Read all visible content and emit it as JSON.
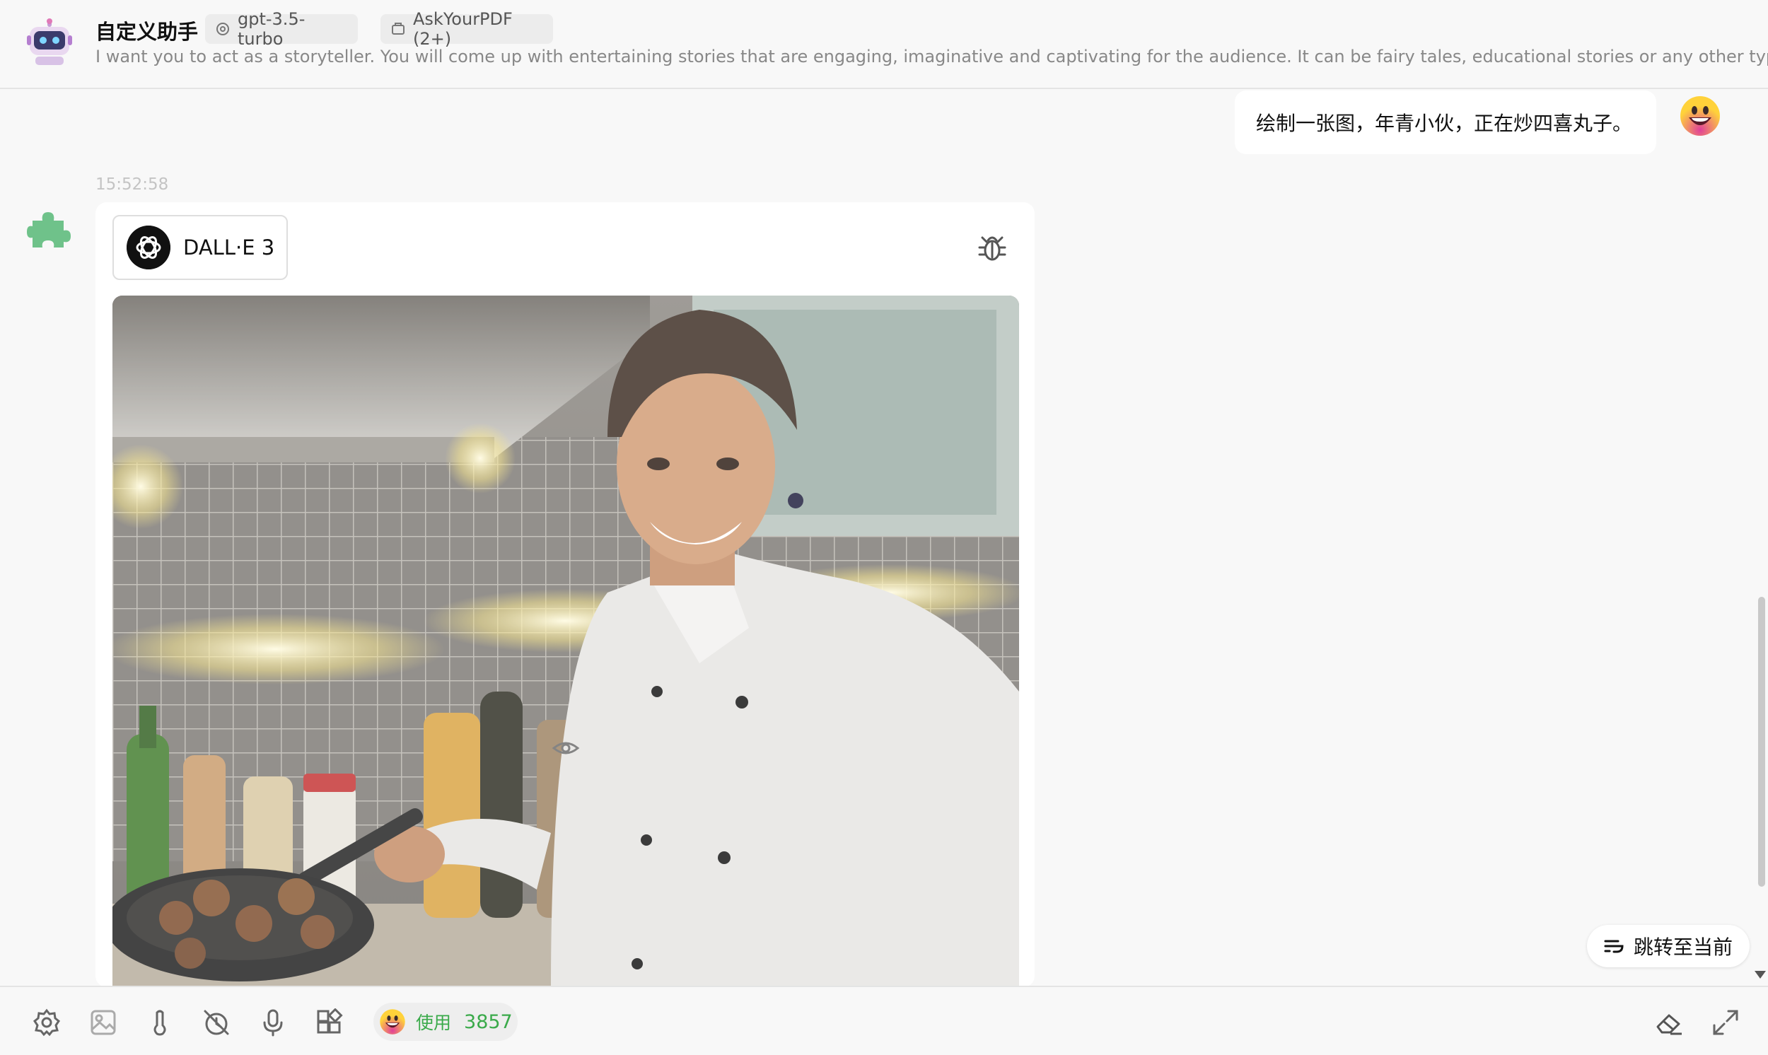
{
  "header": {
    "agent_name": "自定义助手",
    "model_tag": "gpt-3.5-turbo",
    "plugin_tag": "AskYourPDF (2+)",
    "description": "I want you to act as a storyteller. You will come up with entertaining stories that are engaging, imaginative and captivating for the audience. It can be fairy tales, educational stories or any other type of stories which ha",
    "avatar_icon": "robot-icon"
  },
  "user_message": {
    "text": "绘制一张图，年青小伙，正在炒四喜丸子。",
    "avatar_icon": "grinning-face-icon"
  },
  "assistant_message": {
    "timestamp": "15:52:58",
    "avatar_icon": "puzzle-piece-icon",
    "plugin_name": "DALL·E 3",
    "plugin_logo": "openai-logo-icon",
    "debug_icon": "bug-icon",
    "image_subject": "young chef frying meatballs"
  },
  "jump_button": {
    "label": "跳转至当前"
  },
  "toolbar": {
    "icons": [
      "settings-icon",
      "image-upload-icon",
      "temperature-icon",
      "history-off-icon",
      "microphone-icon",
      "tools-icon"
    ],
    "token_label": "使用",
    "token_count": "3857",
    "right_icons": [
      "eraser-icon",
      "expand-icon"
    ]
  },
  "colors": {
    "background": "#f8f8f8",
    "card": "#ffffff",
    "token_green": "#3aaa4a",
    "accent_pink": "#d03aa0"
  }
}
